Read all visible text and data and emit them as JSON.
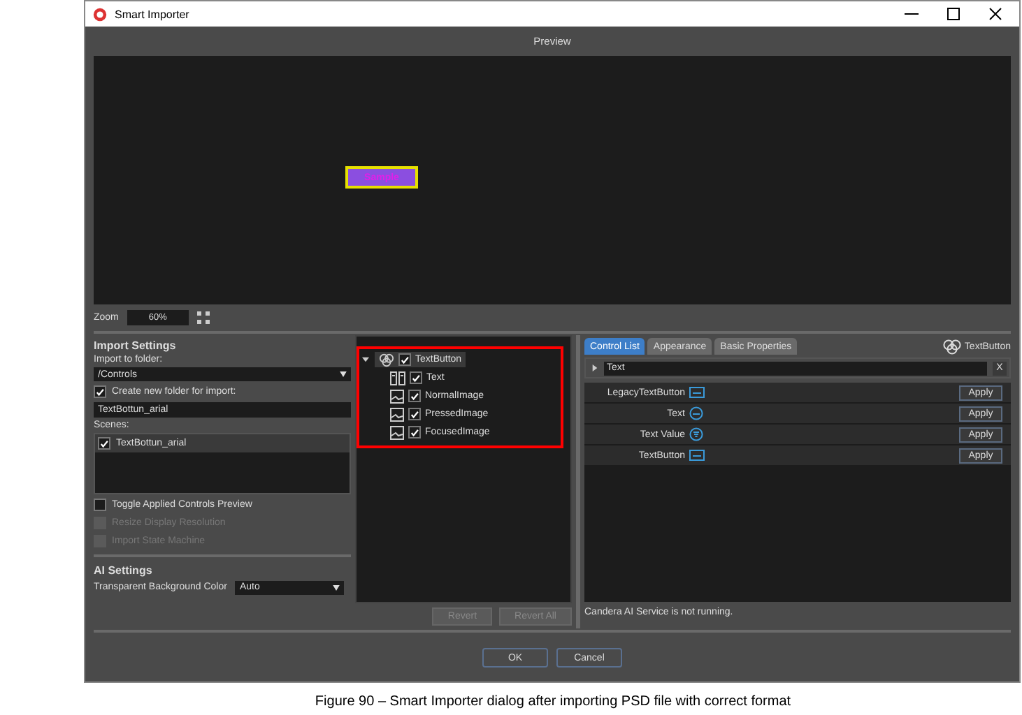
{
  "window": {
    "title": "Smart Importer"
  },
  "preview": {
    "label": "Preview",
    "sample_text": "Sample"
  },
  "zoom": {
    "label": "Zoom",
    "value": "60%"
  },
  "import_settings": {
    "heading": "Import Settings",
    "folder_label": "Import to folder:",
    "folder_value": "/Controls",
    "create_folder": {
      "label": "Create new folder for import:",
      "checked": true
    },
    "folder_name": "TextBottun_arial",
    "scenes_label": "Scenes:",
    "scenes": [
      {
        "label": "TextBottun_arial",
        "checked": true
      }
    ],
    "options": [
      {
        "label": "Toggle Applied Controls Preview",
        "checked": false,
        "disabled": false
      },
      {
        "label": "Resize Display Resolution",
        "checked": false,
        "disabled": true
      },
      {
        "label": "Import State Machine",
        "checked": false,
        "disabled": true
      }
    ]
  },
  "ai_settings": {
    "heading": "AI Settings",
    "bg_label": "Transparent Background Color",
    "bg_value": "Auto"
  },
  "tree": {
    "label": "TextButton",
    "checked": true,
    "expanded": true,
    "selected": true,
    "children": [
      {
        "label": "Text",
        "checked": true,
        "kind": "text",
        "selected": false
      },
      {
        "label": "NormalImage",
        "checked": true,
        "kind": "image",
        "selected": false
      },
      {
        "label": "PressedImage",
        "checked": true,
        "kind": "image",
        "selected": false
      },
      {
        "label": "FocusedImage",
        "checked": true,
        "kind": "image",
        "selected": false
      }
    ]
  },
  "tree_buttons": [
    {
      "label": "Revert",
      "disabled": true
    },
    {
      "label": "Revert All",
      "disabled": true
    }
  ],
  "right": {
    "tabs": [
      {
        "label": "Control List",
        "selected": true
      },
      {
        "label": "Appearance",
        "selected": false
      },
      {
        "label": "Basic Properties",
        "selected": false
      }
    ],
    "target": "TextButton",
    "search": "Text",
    "clear": "X",
    "controls": [
      {
        "name": "LegacyTextButton",
        "kind": "box",
        "apply": "Apply"
      },
      {
        "name": "Text",
        "kind": "round",
        "apply": "Apply"
      },
      {
        "name": "Text Value",
        "kind": "filter",
        "apply": "Apply"
      },
      {
        "name": "TextButton",
        "kind": "box",
        "apply": "Apply"
      }
    ],
    "status": "Candera AI Service is not running."
  },
  "buttons": [
    "OK",
    "Cancel"
  ],
  "caption": "Figure 90 – Smart Importer dialog after importing PSD file with correct format"
}
